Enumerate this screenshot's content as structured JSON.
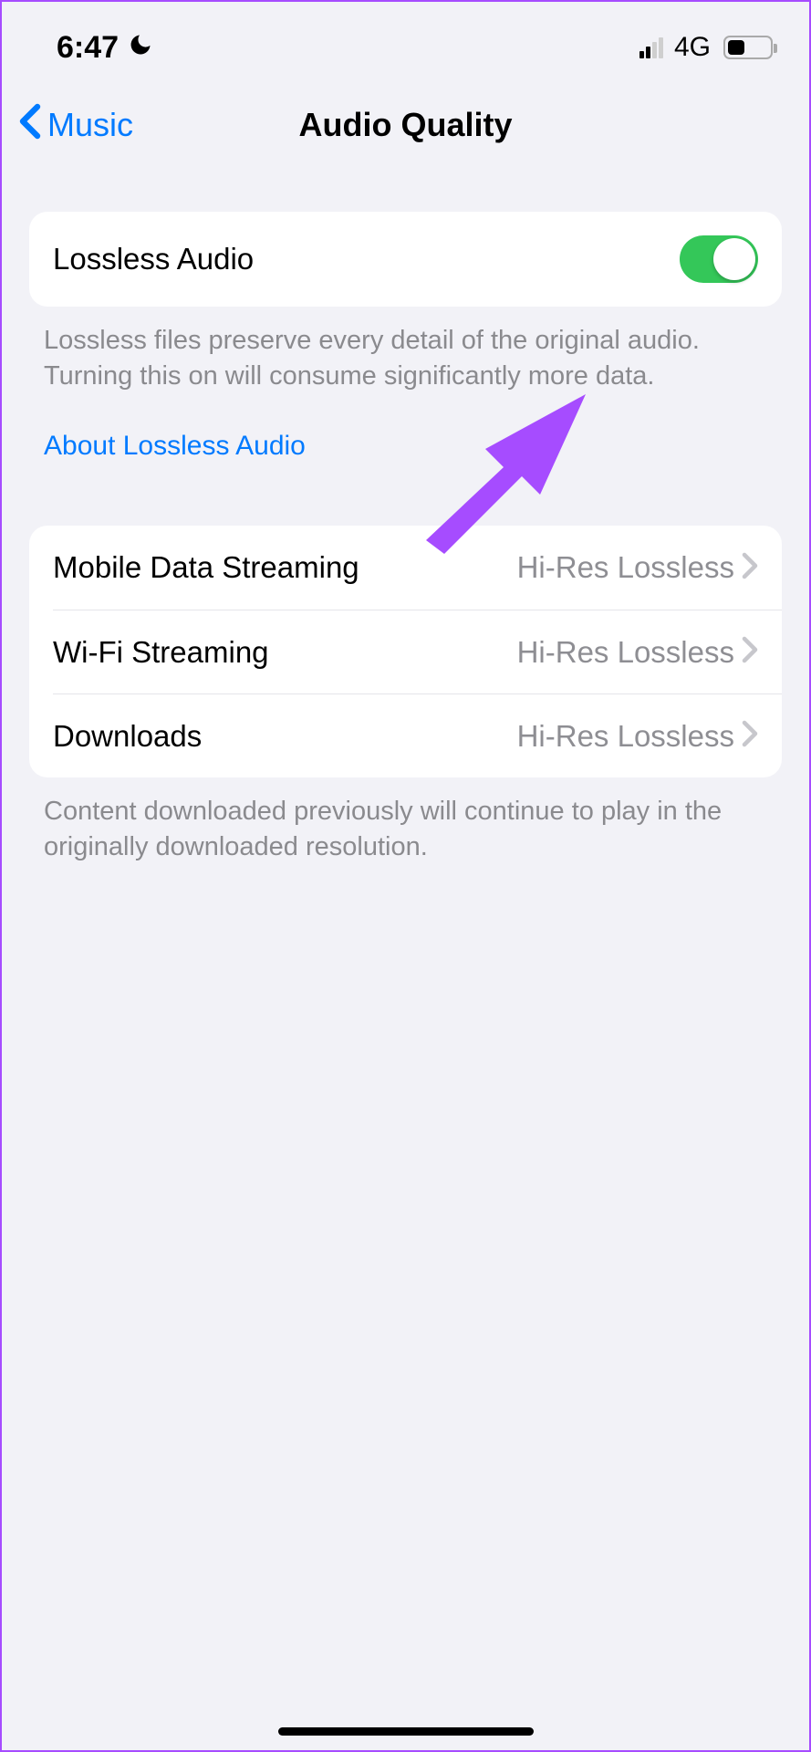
{
  "status": {
    "time": "6:47",
    "network": "4G"
  },
  "nav": {
    "back_label": "Music",
    "title": "Audio Quality"
  },
  "lossless": {
    "label": "Lossless Audio",
    "enabled": true,
    "caption": "Lossless files preserve every detail of the original audio. Turning this on will consume significantly more data.",
    "link_label": "About Lossless Audio"
  },
  "quality_rows": [
    {
      "label": "Mobile Data Streaming",
      "value": "Hi-Res Lossless"
    },
    {
      "label": "Wi-Fi Streaming",
      "value": "Hi-Res Lossless"
    },
    {
      "label": "Downloads",
      "value": "Hi-Res Lossless"
    }
  ],
  "quality_caption": "Content downloaded previously will continue to play in the originally downloaded resolution."
}
